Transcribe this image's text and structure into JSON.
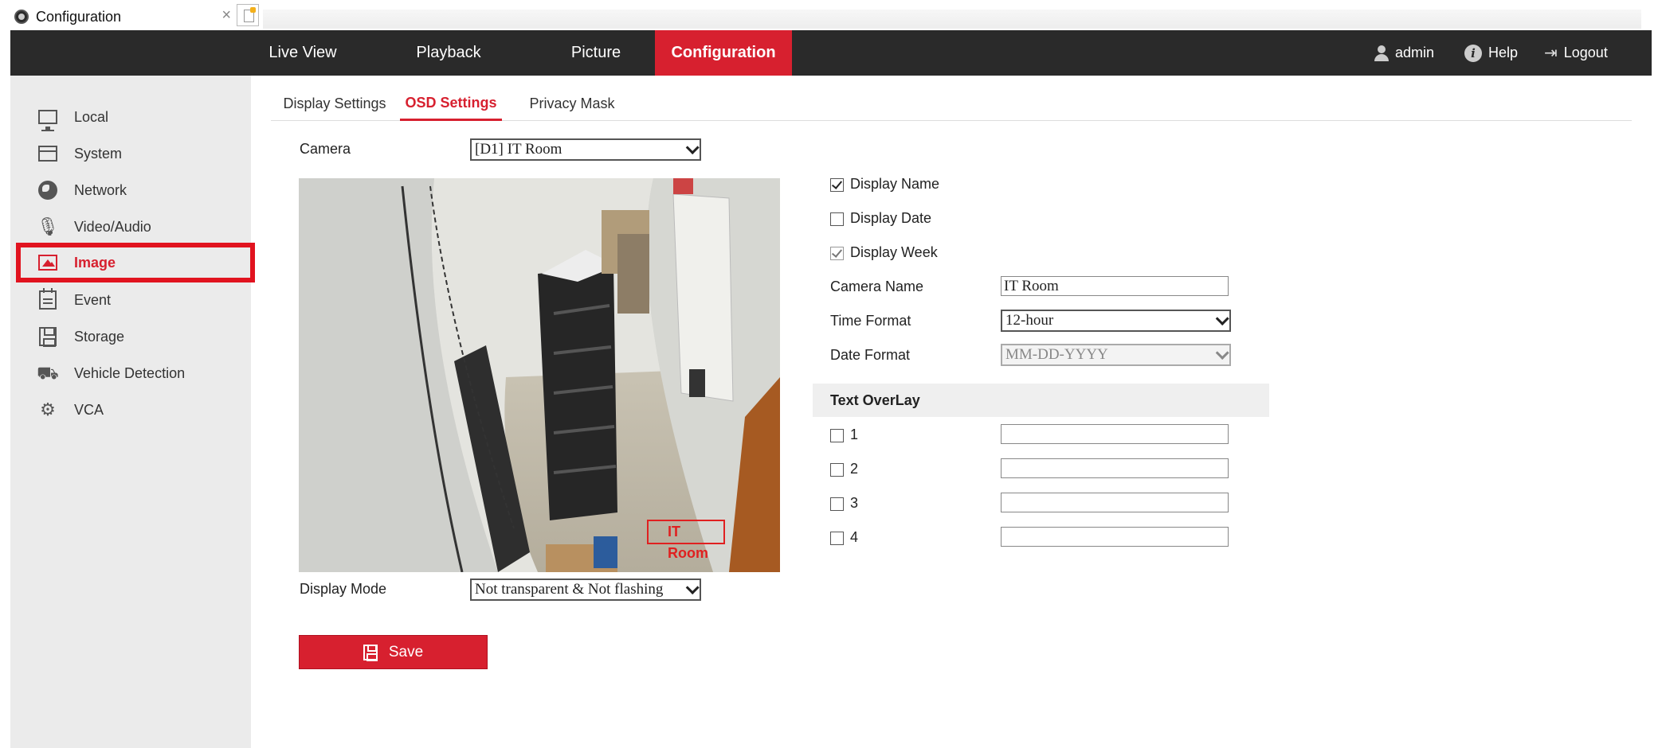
{
  "browser": {
    "tab_title": "Configuration",
    "close_glyph": "×"
  },
  "topnav": {
    "items": [
      "Live View",
      "Playback",
      "Picture",
      "Configuration"
    ],
    "active": "Configuration",
    "user": "admin",
    "help": "Help",
    "logout": "Logout"
  },
  "sidebar": {
    "items": [
      {
        "label": "Local",
        "icon": "monitor-icon"
      },
      {
        "label": "System",
        "icon": "system-icon"
      },
      {
        "label": "Network",
        "icon": "globe-icon"
      },
      {
        "label": "Video/Audio",
        "icon": "microphone-icon"
      },
      {
        "label": "Image",
        "icon": "image-icon"
      },
      {
        "label": "Event",
        "icon": "calendar-icon"
      },
      {
        "label": "Storage",
        "icon": "disk-icon"
      },
      {
        "label": "Vehicle Detection",
        "icon": "vehicle-icon"
      },
      {
        "label": "VCA",
        "icon": "vca-icon"
      }
    ],
    "active": "Image"
  },
  "subtabs": {
    "items": [
      "Display Settings",
      "OSD Settings",
      "Privacy Mask"
    ],
    "active": "OSD Settings"
  },
  "form": {
    "camera_label": "Camera",
    "camera_value": "[D1] IT Room",
    "display_mode_label": "Display Mode",
    "display_mode_value": "Not transparent & Not flashing",
    "osd_preview_text": "IT Room",
    "display_name": {
      "label": "Display Name",
      "checked": true
    },
    "display_date": {
      "label": "Display Date",
      "checked": false
    },
    "display_week": {
      "label": "Display Week",
      "checked": true,
      "disabled": true
    },
    "camera_name_label": "Camera Name",
    "camera_name_value": "IT Room",
    "time_format_label": "Time Format",
    "time_format_value": "12-hour",
    "date_format_label": "Date Format",
    "date_format_value": "MM-DD-YYYY",
    "text_overlay_header": "Text OverLay",
    "overlays": [
      {
        "label": "1",
        "checked": false,
        "value": ""
      },
      {
        "label": "2",
        "checked": false,
        "value": ""
      },
      {
        "label": "3",
        "checked": false,
        "value": ""
      },
      {
        "label": "4",
        "checked": false,
        "value": ""
      }
    ],
    "save_label": "Save"
  },
  "colors": {
    "accent": "#d7202f",
    "navbar": "#2a2a2a",
    "sidebar": "#ebebeb"
  }
}
